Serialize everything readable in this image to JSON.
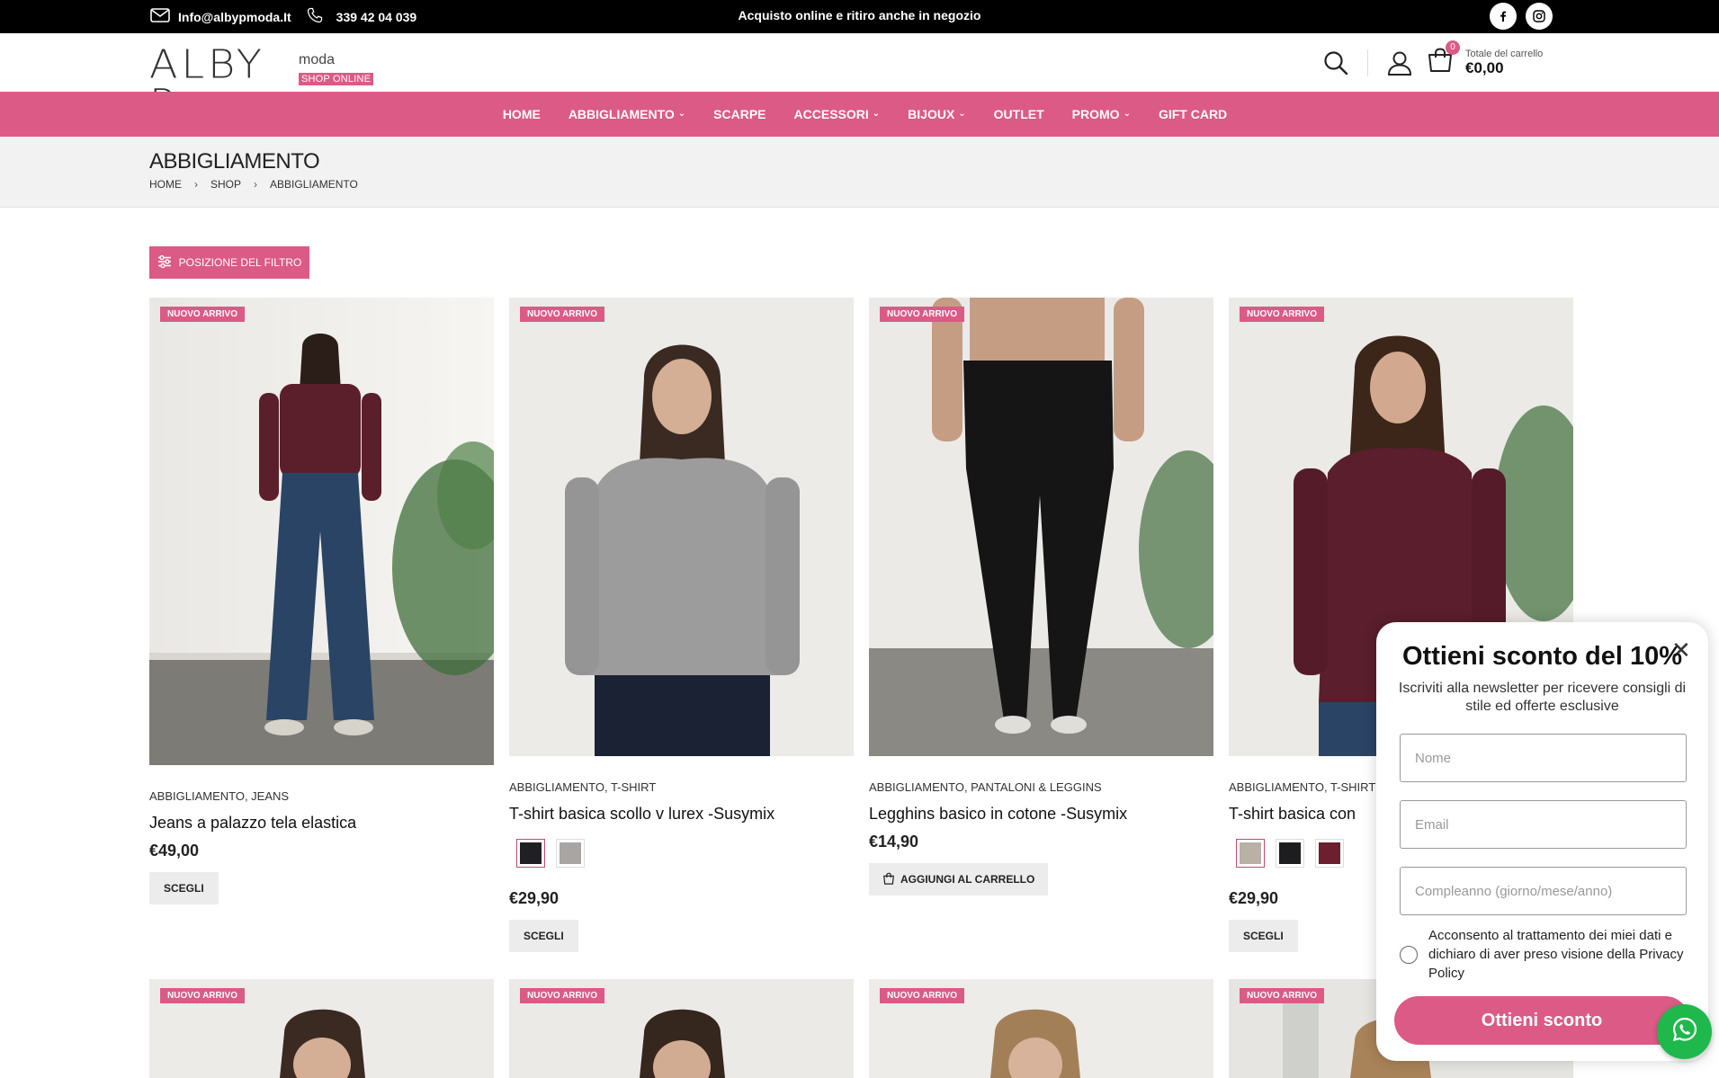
{
  "topbar": {
    "email": "Info@albypmoda.It",
    "phone": "339 42 04 039",
    "promo": "Acquisto online e ritiro anche in negozio"
  },
  "header": {
    "logo_main": "ALBY P.",
    "logo_sub": "moda",
    "logo_tag": "SHOP ONLINE",
    "cart_count": "0",
    "cart_label": "Totale del carrello",
    "cart_total": "€0,00"
  },
  "nav": {
    "items": [
      {
        "label": "HOME"
      },
      {
        "label": "ABBIGLIAMENTO"
      },
      {
        "label": "SCARPE"
      },
      {
        "label": "ACCESSORI"
      },
      {
        "label": "BIJOUX"
      },
      {
        "label": "OUTLET"
      },
      {
        "label": "PROMO"
      },
      {
        "label": "GIFT CARD"
      }
    ]
  },
  "page": {
    "title": "ABBIGLIAMENTO",
    "breadcrumb": [
      "HOME",
      "SHOP",
      "ABBIGLIAMENTO"
    ],
    "filter_label": "POSIZIONE DEL FILTRO"
  },
  "products": [
    {
      "badge": "NUOVO ARRIVO",
      "cats": "ABBIGLIAMENTO, JEANS",
      "name": "Jeans a palazzo tela elastica",
      "price": "€49,00",
      "button": "SCEGLI"
    },
    {
      "badge": "NUOVO ARRIVO",
      "cats": "ABBIGLIAMENTO, T-SHIRT",
      "name": "T-shirt basica scollo v lurex -Susymix",
      "price": "€29,90",
      "button": "SCEGLI"
    },
    {
      "badge": "NUOVO ARRIVO",
      "cats": "ABBIGLIAMENTO, PANTALONI & LEGGINS",
      "name": "Legghins basico in cotone -Susymix",
      "price": "€14,90",
      "button": "AGGIUNGI AL CARRELLO"
    },
    {
      "badge": "NUOVO ARRIVO",
      "cats": "ABBIGLIAMENTO, T-SHIRT",
      "name": "T-shirt basica con",
      "price": "€29,90",
      "button": "SCEGLI"
    }
  ],
  "row2_badges": [
    "NUOVO ARRIVO",
    "NUOVO ARRIVO",
    "NUOVO ARRIVO",
    "NUOVO ARRIVO"
  ],
  "popup": {
    "title": "Ottieni sconto del 10%",
    "subtitle": "Iscriviti alla newsletter per ricevere consigli di stile ed offerte esclusive",
    "name_placeholder": "Nome",
    "email_placeholder": "Email",
    "birthday_placeholder": "Compleanno (giorno/mese/anno)",
    "consent": "Acconsento al trattamento dei miei dati e dichiaro di aver preso visione della Privacy Policy",
    "cta": "Ottieni sconto"
  },
  "colors": {
    "accent": "#dc5a86",
    "topbar": "#000000",
    "whatsapp": "#1fb84c"
  }
}
